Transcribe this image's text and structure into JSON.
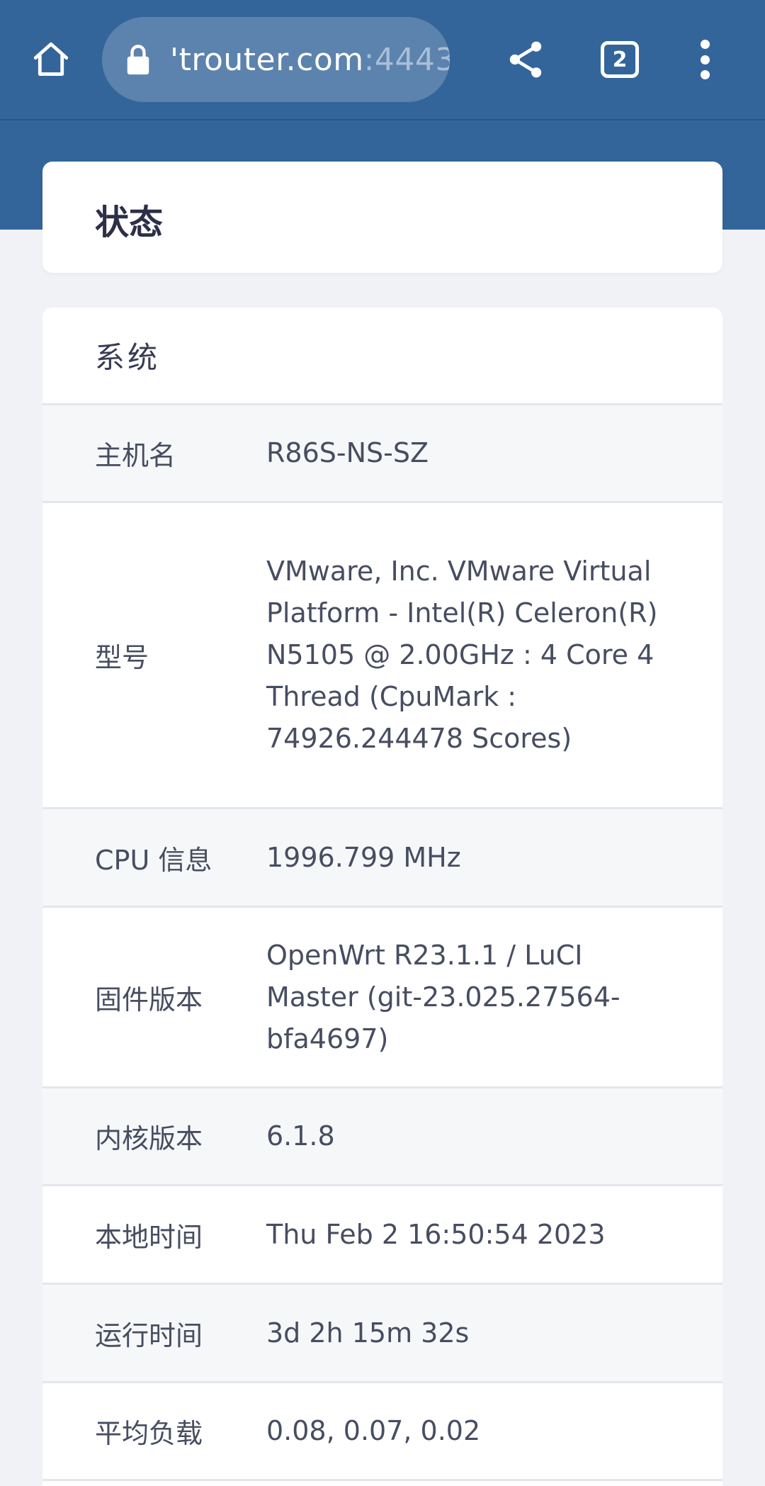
{
  "browser": {
    "url_host": "'trouter.com",
    "url_port": ":4443",
    "tab_count": "2",
    "icons": [
      "home-icon",
      "lock-icon",
      "share-icon",
      "tabs-icon",
      "more-vert-icon"
    ]
  },
  "page": {
    "title": "状态"
  },
  "system": {
    "section_title": "系统",
    "rows": [
      {
        "label": "主机名",
        "value": "R86S-NS-SZ"
      },
      {
        "label": "型号",
        "value": "VMware, Inc. VMware Virtual Platform - Intel(R) Celeron(R) N5105 @ 2.00GHz : 4 Core 4 Thread (CpuMark : 74926.244478 Scores)"
      },
      {
        "label": "CPU 信息",
        "value": "1996.799 MHz"
      },
      {
        "label": "固件版本",
        "value": "OpenWrt R23.1.1 / LuCI Master (git-23.025.27564-bfa4697)"
      },
      {
        "label": "内核版本",
        "value": "6.1.8"
      },
      {
        "label": "本地时间",
        "value": "Thu Feb 2 16:50:54 2023"
      },
      {
        "label": "运行时间",
        "value": "3d 2h 15m 32s"
      },
      {
        "label": "平均负载",
        "value": "0.08, 0.07, 0.02"
      }
    ]
  },
  "colors": {
    "header_blue": "#33659a",
    "url_pill": "#5c83ad",
    "page_bg": "#f1f2f6",
    "text": "#474d61"
  }
}
